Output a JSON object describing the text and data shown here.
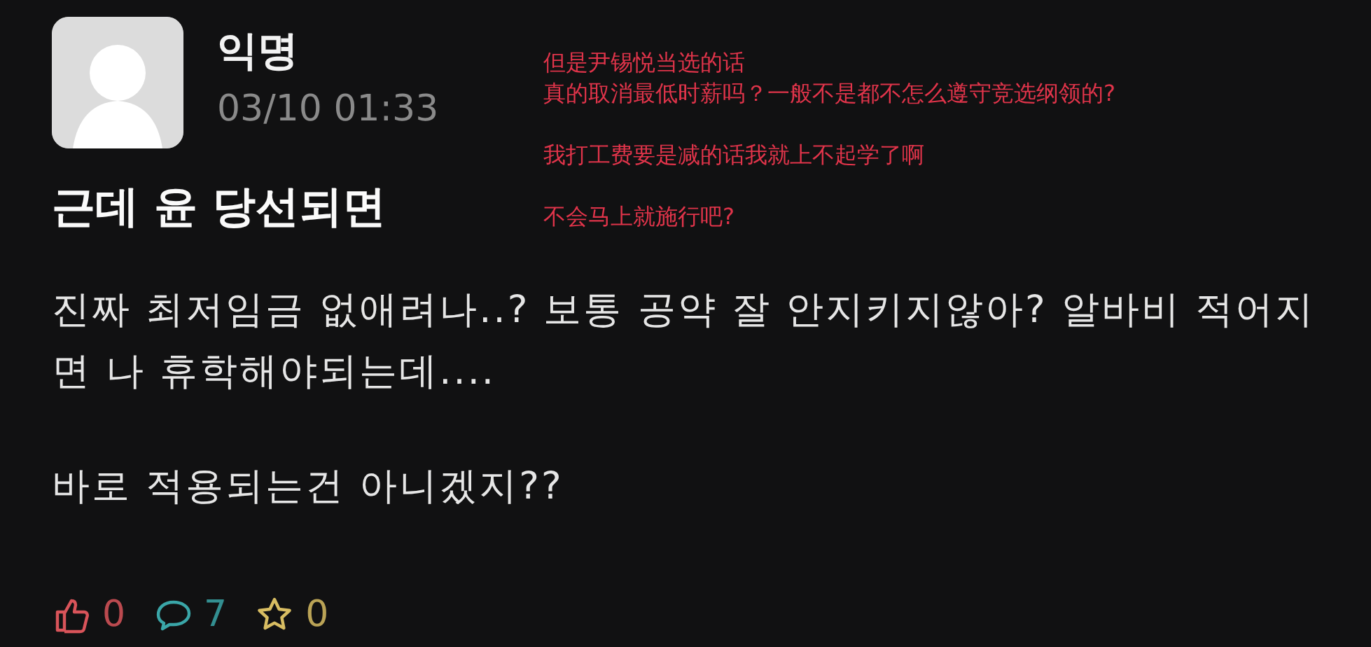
{
  "post": {
    "author": "익명",
    "time": "03/10 01:33",
    "title": "근데 윤 당선되면",
    "body": [
      "진짜 최저임금 없애려나..? 보통 공약 잘 안지키지않아? 알바비 적어지면 나 휴학해야되는데....",
      "바로 적용되는건 아니겠지??"
    ]
  },
  "annotations": [
    [
      "但是尹锡悦当选的话",
      "真的取消最低时薪吗？一般不是都不怎么遵守竞选纲领的?"
    ],
    [
      "我打工费要是减的话我就上不起学了啊"
    ],
    [
      "不会马上就施行吧?"
    ]
  ],
  "actions": [
    {
      "kind": "like",
      "count": "0",
      "color": "#d9545a"
    },
    {
      "kind": "comment",
      "count": "7",
      "color": "#3aa6a8"
    },
    {
      "kind": "scrap",
      "count": "0",
      "color": "#d8bd62"
    }
  ]
}
